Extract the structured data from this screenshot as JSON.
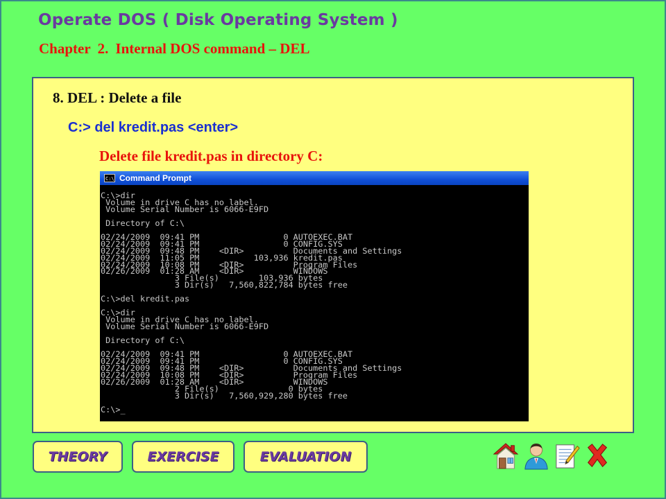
{
  "header": {
    "title": "Operate DOS ( Disk Operating System )",
    "chapter_label": "Chapter",
    "chapter_number": "2.",
    "chapter_topic": "Internal DOS command – DEL"
  },
  "content": {
    "heading": "8. DEL : Delete a file",
    "command": "C:> del kredit.pas <enter>",
    "description": "Delete file kredit.pas in directory C:"
  },
  "command_window": {
    "title": "Command Prompt",
    "icon_text": "C:\\",
    "output": "C:\\>dir\n Volume in drive C has no label.\n Volume Serial Number is 6066-E9FD\n\n Directory of C:\\\n\n02/24/2009  09:41 PM                 0 AUTOEXEC.BAT\n02/24/2009  09:41 PM                 0 CONFIG.SYS\n02/24/2009  09:48 PM    <DIR>          Documents and Settings\n02/24/2009  11:05 PM           103,936 kredit.pas\n02/24/2009  10:08 PM    <DIR>          Program Files\n02/26/2009  01:28 AM    <DIR>          WINDOWS\n               3 File(s)        103,936 bytes\n               3 Dir(s)   7,560,822,784 bytes free\n\nC:\\>del kredit.pas\n\nC:\\>dir\n Volume in drive C has no label.\n Volume Serial Number is 6066-E9FD\n\n Directory of C:\\\n\n02/24/2009  09:41 PM                 0 AUTOEXEC.BAT\n02/24/2009  09:41 PM                 0 CONFIG.SYS\n02/24/2009  09:48 PM    <DIR>          Documents and Settings\n02/24/2009  10:08 PM    <DIR>          Program Files\n02/26/2009  01:28 AM    <DIR>          WINDOWS\n               2 File(s)              0 bytes\n               3 Dir(s)   7,560,929,280 bytes free\n\nC:\\>_"
  },
  "nav": {
    "theory": "THEORY",
    "exercise": "EXERCISE",
    "evaluation": "EVALUATION"
  },
  "icons": [
    "home-icon",
    "user-icon",
    "notepad-icon",
    "close-icon"
  ],
  "colors": {
    "background": "#66ff66",
    "panel": "#ffff80",
    "title": "#6a3aa0",
    "chapter": "#e8140c",
    "command": "#1a2fd0",
    "border": "#3b5f86"
  }
}
